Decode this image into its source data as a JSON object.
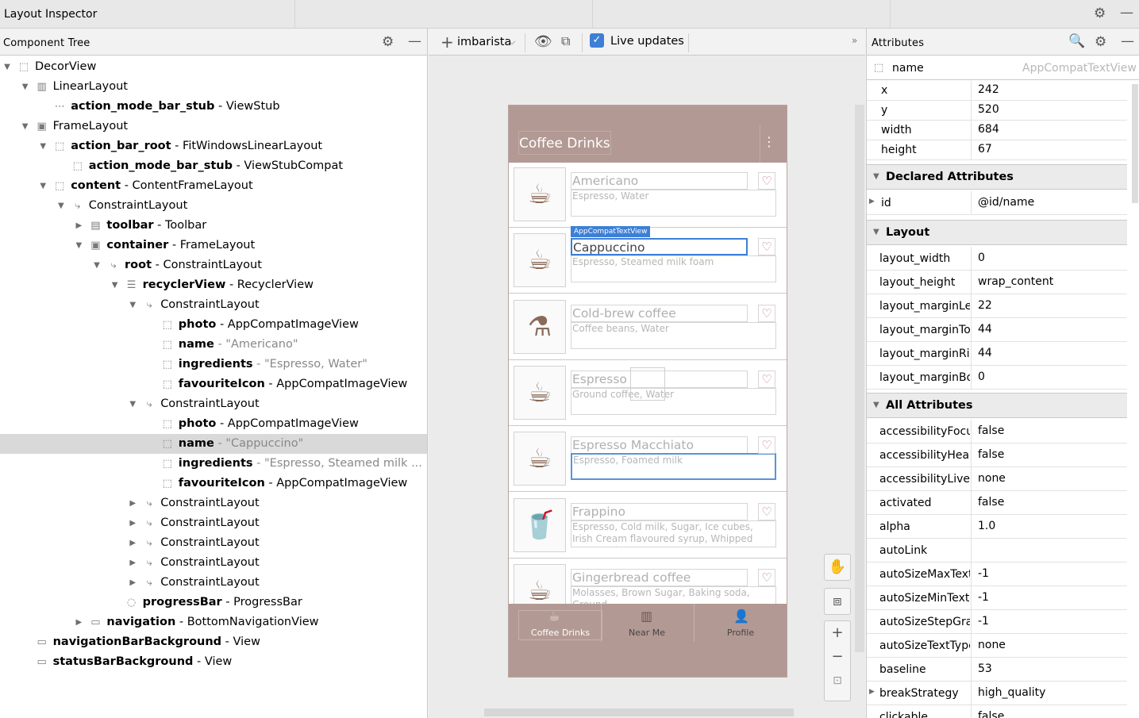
{
  "window": {
    "title": "Layout Inspector"
  },
  "tree": {
    "header": "Component Tree",
    "rows": [
      {
        "name": "DecorView",
        "detail": ""
      },
      {
        "name": "LinearLayout",
        "detail": ""
      },
      {
        "name": "action_mode_bar_stub",
        "detail": " - ViewStub"
      },
      {
        "name": "FrameLayout",
        "detail": ""
      },
      {
        "name": "action_bar_root",
        "detail": " - FitWindowsLinearLayout"
      },
      {
        "name": "action_mode_bar_stub",
        "detail": " - ViewStubCompat"
      },
      {
        "name": "content",
        "detail": " - ContentFrameLayout"
      },
      {
        "name": "ConstraintLayout",
        "detail": ""
      },
      {
        "name": "toolbar",
        "detail": " - Toolbar"
      },
      {
        "name": "container",
        "detail": " - FrameLayout"
      },
      {
        "name": "root",
        "detail": " - ConstraintLayout"
      },
      {
        "name": "recyclerView",
        "detail": " - RecyclerView"
      },
      {
        "name": "ConstraintLayout",
        "detail": ""
      },
      {
        "name": "photo",
        "detail": " - AppCompatImageView"
      },
      {
        "name": "name",
        "detail": " - \"Americano\""
      },
      {
        "name": "ingredients",
        "detail": " - \"Espresso, Water\""
      },
      {
        "name": "favouriteIcon",
        "detail": " - AppCompatImageView"
      },
      {
        "name": "ConstraintLayout",
        "detail": ""
      },
      {
        "name": "photo",
        "detail": " - AppCompatImageView"
      },
      {
        "name": "name",
        "detail": " - \"Cappuccino\""
      },
      {
        "name": "ingredients",
        "detail": " - \"Espresso, Steamed milk ..."
      },
      {
        "name": "favouriteIcon",
        "detail": " - AppCompatImageView"
      },
      {
        "name": "ConstraintLayout",
        "detail": ""
      },
      {
        "name": "ConstraintLayout",
        "detail": ""
      },
      {
        "name": "ConstraintLayout",
        "detail": ""
      },
      {
        "name": "ConstraintLayout",
        "detail": ""
      },
      {
        "name": "ConstraintLayout",
        "detail": ""
      },
      {
        "name": "progressBar",
        "detail": " - ProgressBar"
      },
      {
        "name": "navigation",
        "detail": " - BottomNavigationView"
      },
      {
        "name": "navigationBarBackground",
        "detail": " - View"
      },
      {
        "name": "statusBarBackground",
        "detail": " - View"
      }
    ]
  },
  "toolbar": {
    "process": "imbarista",
    "live_updates": "Live updates"
  },
  "device": {
    "app_title": "Coffee Drinks",
    "selection_tag": "AppCompatTextView",
    "cards": [
      {
        "name": "Americano",
        "ingredients": "Espresso, Water"
      },
      {
        "name": "Cappuccino",
        "ingredients": "Espresso, Steamed milk foam"
      },
      {
        "name": "Cold-brew coffee",
        "ingredients": "Coffee beans, Water"
      },
      {
        "name": "Espresso",
        "ingredients": "Ground coffee, Water"
      },
      {
        "name": "Espresso Macchiato",
        "ingredients": "Espresso, Foamed milk"
      },
      {
        "name": "Frappino",
        "ingredients": "Espresso, Cold milk, Sugar, Ice cubes, Irish Cream flavoured syrup, Whipped cream, Cho..."
      },
      {
        "name": "Gingerbread coffee",
        "ingredients": "Molasses, Brown Sugar, Baking soda, Ground"
      }
    ],
    "nav": [
      "Coffee Drinks",
      "Near Me",
      "Profile"
    ]
  },
  "attributes": {
    "header": "Attributes",
    "name_label": "name",
    "name_class": "AppCompatTextView",
    "basic": [
      {
        "k": "x",
        "v": "242"
      },
      {
        "k": "y",
        "v": "520"
      },
      {
        "k": "width",
        "v": "684"
      },
      {
        "k": "height",
        "v": "67"
      }
    ],
    "declared_title": "Declared Attributes",
    "declared": [
      {
        "k": "id",
        "v": "@id/name"
      }
    ],
    "layout_title": "Layout",
    "layout": [
      {
        "k": "layout_width",
        "v": "0"
      },
      {
        "k": "layout_height",
        "v": "wrap_content"
      },
      {
        "k": "layout_marginLeft",
        "v": "22"
      },
      {
        "k": "layout_marginTop",
        "v": "44"
      },
      {
        "k": "layout_marginRig...",
        "v": "44"
      },
      {
        "k": "layout_marginBo...",
        "v": "0"
      }
    ],
    "all_title": "All Attributes",
    "all": [
      {
        "k": "accessibilityFocu...",
        "v": "false"
      },
      {
        "k": "accessibilityHead...",
        "v": "false"
      },
      {
        "k": "accessibilityLiveR...",
        "v": "none"
      },
      {
        "k": "activated",
        "v": "false"
      },
      {
        "k": "alpha",
        "v": "1.0"
      },
      {
        "k": "autoLink",
        "v": ""
      },
      {
        "k": "autoSizeMaxText...",
        "v": "-1"
      },
      {
        "k": "autoSizeMinText...",
        "v": "-1"
      },
      {
        "k": "autoSizeStepGra...",
        "v": "-1"
      },
      {
        "k": "autoSizeTextType",
        "v": "none"
      },
      {
        "k": "baseline",
        "v": "53"
      },
      {
        "k": "breakStrategy",
        "v": "high_quality"
      },
      {
        "k": "clickable",
        "v": "false"
      }
    ]
  }
}
